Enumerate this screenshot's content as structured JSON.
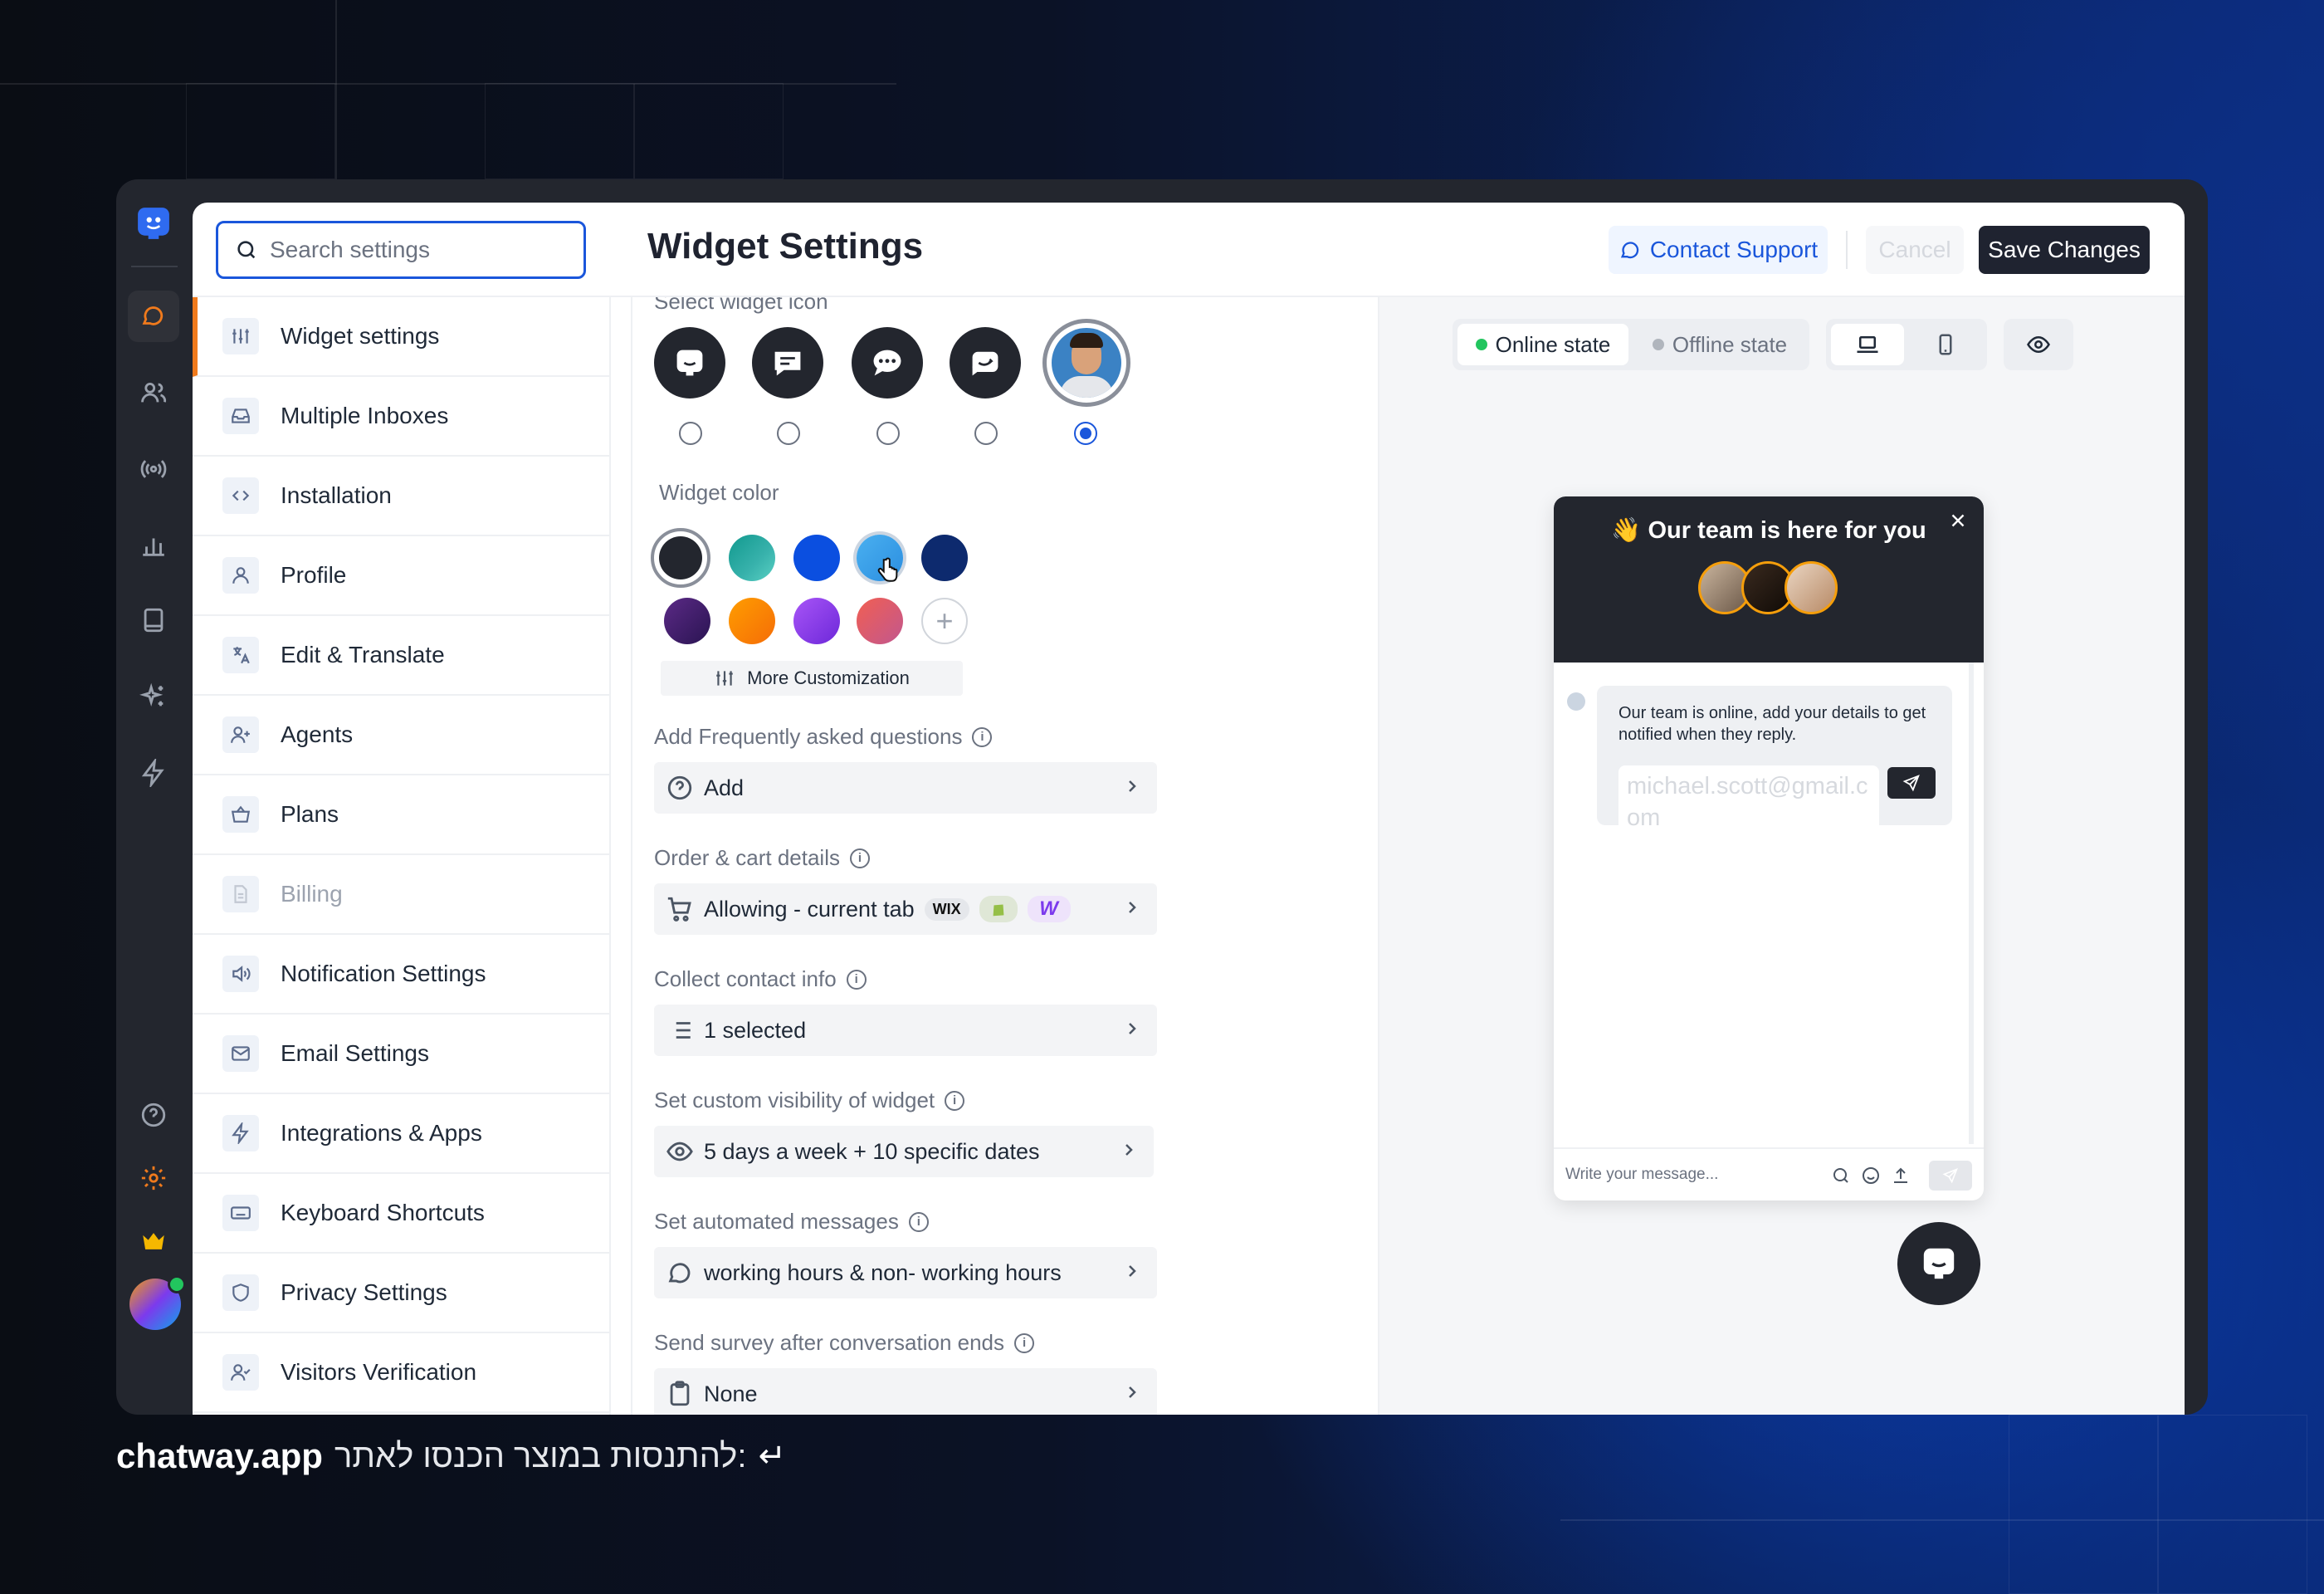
{
  "search": {
    "placeholder": "Search settings"
  },
  "page_title": "Widget Settings",
  "header": {
    "contact_support": "Contact Support",
    "cancel": "Cancel",
    "save": "Save Changes"
  },
  "sidebar": {
    "items": [
      {
        "label": "Widget settings",
        "icon": "sliders-icon"
      },
      {
        "label": "Multiple Inboxes",
        "icon": "inbox-icon"
      },
      {
        "label": "Installation",
        "icon": "code-icon"
      },
      {
        "label": "Profile",
        "icon": "user-icon"
      },
      {
        "label": "Edit & Translate",
        "icon": "translate-icon"
      },
      {
        "label": "Agents",
        "icon": "add-user-icon"
      },
      {
        "label": "Plans",
        "icon": "basket-icon"
      },
      {
        "label": "Billing",
        "icon": "document-icon"
      },
      {
        "label": "Notification Settings",
        "icon": "speaker-icon"
      },
      {
        "label": "Email Settings",
        "icon": "mail-icon"
      },
      {
        "label": "Integrations & Apps",
        "icon": "bolt-icon"
      },
      {
        "label": "Keyboard Shortcuts",
        "icon": "keyboard-icon"
      },
      {
        "label": "Privacy Settings",
        "icon": "shield-icon"
      },
      {
        "label": "Visitors Verification",
        "icon": "user-check-icon"
      }
    ]
  },
  "settings": {
    "select_widget_icon": "Select widget icon",
    "widget_color": "Widget color",
    "more_customization": "More Customization",
    "faq": {
      "label": "Add Frequently asked questions",
      "value": "Add"
    },
    "order": {
      "label": "Order & cart details",
      "value": "Allowing - current tab",
      "badge_wix": "WIX"
    },
    "contact": {
      "label": "Collect contact info",
      "value": "1 selected"
    },
    "visibility": {
      "label": "Set custom visibility of widget",
      "value": "5 days a week + 10 specific dates"
    },
    "automated": {
      "label": "Set automated messages",
      "value": "working hours & non- working hours"
    },
    "survey": {
      "label": "Send survey after conversation ends",
      "value": "None"
    }
  },
  "colors": {
    "swatches": [
      "#23262e",
      "#1aa39a",
      "#0b4fe0",
      "#4ab0f0",
      "#0d2a6e",
      "#3b1a66",
      "#f58a07",
      "#8c35e0",
      "#e0565a"
    ],
    "accent": "#1a56db",
    "active_tab": "#f07a1c"
  },
  "preview": {
    "online": "Online state",
    "offline": "Offline state",
    "chat_title": "👋 Our team is here for you",
    "message": "Our team is online, add your details to get notified when they reply.",
    "email_placeholder": "michael.scott@gmail.com",
    "input_placeholder": "Write your message..."
  },
  "footer": {
    "brand": "chatway.app",
    "text": "להתנסות במוצר הכנסו לאתר:",
    "arrow": "↵"
  }
}
